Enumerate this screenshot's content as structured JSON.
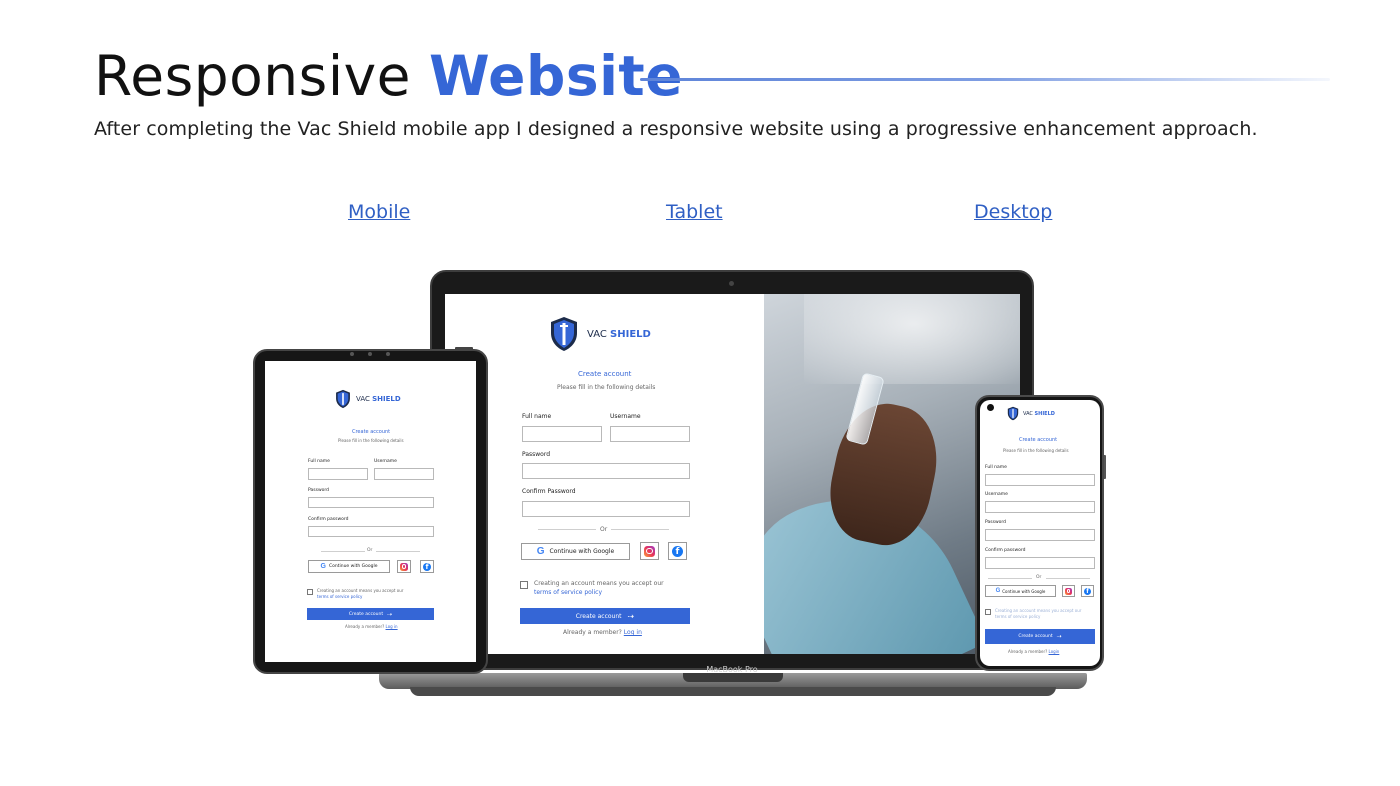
{
  "header": {
    "title_plain": "Responsive",
    "title_accent": "Website",
    "subtitle": "After completing the Vac Shield mobile app I designed a responsive website using a progressive enhancement approach."
  },
  "device_links": {
    "mobile": "Mobile",
    "tablet": "Tablet",
    "desktop": "Desktop"
  },
  "laptop": {
    "model": "MacBook Pro"
  },
  "brand": {
    "name_plain": "VAC",
    "name_bold": "SHIELD"
  },
  "form": {
    "heading": "Create account",
    "subheading": "Please fill in the following details",
    "fullname_label": "Full name",
    "username_label": "Username",
    "password_label": "Password",
    "confirm_label_desktop": "Confirm Password",
    "confirm_label": "Confirm password",
    "or_text": "Or",
    "google_label": "Continue with Google",
    "terms_prefix": "Creating an account means you accept our",
    "terms_link": "terms of service policy",
    "submit_label": "Create account",
    "member_text": "Already a member?",
    "login_link": "Log in",
    "login_link_alt": "Login"
  },
  "colors": {
    "accent": "#3566d6",
    "text": "#111111"
  },
  "icons": [
    "shield-syringe-logo",
    "google-icon",
    "instagram-icon",
    "facebook-icon",
    "login-arrow-icon"
  ]
}
